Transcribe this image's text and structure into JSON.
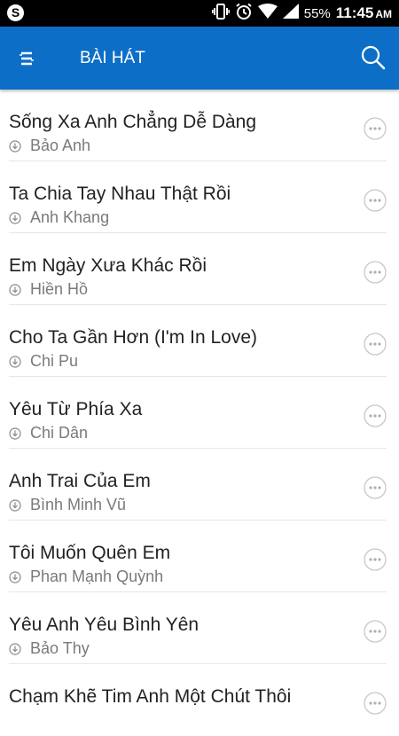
{
  "status_bar": {
    "app_icon": "skype-icon",
    "battery": "55%",
    "time": "11:45",
    "ampm": "AM"
  },
  "app_bar": {
    "title": "BÀI HÁT",
    "menu_icon": "hamburger-menu-icon",
    "search_icon": "search-icon",
    "color": "#0d6ec7"
  },
  "songs": [
    {
      "title": "Sống Xa Anh Chẳng Dễ Dàng",
      "artist": "Bảo Anh"
    },
    {
      "title": "Ta Chia Tay Nhau Thật Rồi",
      "artist": "Anh Khang"
    },
    {
      "title": "Em Ngày Xưa Khác Rồi",
      "artist": "Hiền Hồ"
    },
    {
      "title": "Cho Ta Gần Hơn (I'm In Love)",
      "artist": "Chi Pu"
    },
    {
      "title": "Yêu Từ Phía Xa",
      "artist": "Chi Dân"
    },
    {
      "title": "Anh Trai Của Em",
      "artist": "Bình Minh Vũ"
    },
    {
      "title": "Tôi Muốn Quên Em",
      "artist": "Phan Mạnh Quỳnh"
    },
    {
      "title": "Yêu Anh Yêu Bình Yên",
      "artist": "Bảo Thy"
    },
    {
      "title": "Chạm Khẽ Tim Anh Một Chút Thôi",
      "artist": ""
    }
  ]
}
